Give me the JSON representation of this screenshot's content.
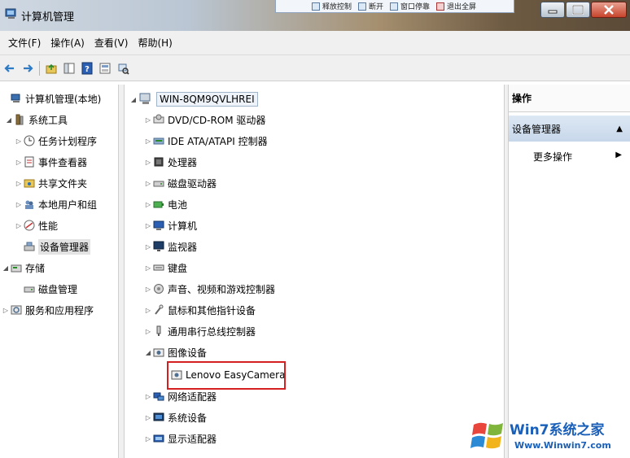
{
  "window": {
    "title": "计算机管理",
    "remote_bar": [
      "释放控制",
      "断开",
      "窗口停靠",
      "退出全屏"
    ]
  },
  "menubar": [
    "文件(F)",
    "操作(A)",
    "查看(V)",
    "帮助(H)"
  ],
  "left_tree": [
    {
      "label": "计算机管理(本地)",
      "icon": "computer-management-icon",
      "level": 0,
      "twisty": ""
    },
    {
      "label": "系统工具",
      "icon": "system-tools-icon",
      "level": 1,
      "twisty": "◢"
    },
    {
      "label": "任务计划程序",
      "icon": "clock-icon",
      "level": 2,
      "twisty": "▷"
    },
    {
      "label": "事件查看器",
      "icon": "event-viewer-icon",
      "level": 2,
      "twisty": "▷"
    },
    {
      "label": "共享文件夹",
      "icon": "shared-folder-icon",
      "level": 2,
      "twisty": "▷"
    },
    {
      "label": "本地用户和组",
      "icon": "users-icon",
      "level": 2,
      "twisty": "▷"
    },
    {
      "label": "性能",
      "icon": "performance-icon",
      "level": 2,
      "twisty": "▷"
    },
    {
      "label": "设备管理器",
      "icon": "device-manager-icon",
      "level": 2,
      "twisty": "",
      "selected": true
    },
    {
      "label": "存储",
      "icon": "storage-icon",
      "level": 0,
      "twisty": "◢"
    },
    {
      "label": "磁盘管理",
      "icon": "disk-management-icon",
      "level": 1,
      "twisty": ""
    },
    {
      "label": "服务和应用程序",
      "icon": "services-icon",
      "level": 0,
      "twisty": "▷"
    }
  ],
  "device_tree": {
    "root": "WIN-8QM9QVLHREI",
    "items": [
      {
        "label": "DVD/CD-ROM 驱动器",
        "icon": "dvd-drive-icon"
      },
      {
        "label": "IDE ATA/ATAPI 控制器",
        "icon": "ide-controller-icon"
      },
      {
        "label": "处理器",
        "icon": "processor-icon"
      },
      {
        "label": "磁盘驱动器",
        "icon": "disk-drive-icon"
      },
      {
        "label": "电池",
        "icon": "battery-icon"
      },
      {
        "label": "计算机",
        "icon": "computer-icon"
      },
      {
        "label": "监视器",
        "icon": "monitor-icon"
      },
      {
        "label": "键盘",
        "icon": "keyboard-icon"
      },
      {
        "label": "声音、视频和游戏控制器",
        "icon": "sound-icon"
      },
      {
        "label": "鼠标和其他指针设备",
        "icon": "mouse-icon"
      },
      {
        "label": "通用串行总线控制器",
        "icon": "usb-icon"
      },
      {
        "label": "图像设备",
        "icon": "imaging-device-icon",
        "expanded": true
      },
      {
        "label": "网络适配器",
        "icon": "network-adapter-icon"
      },
      {
        "label": "系统设备",
        "icon": "system-device-icon"
      },
      {
        "label": "显示适配器",
        "icon": "display-adapter-icon"
      }
    ],
    "camera": "Lenovo EasyCamera"
  },
  "actions_panel": {
    "header": "操作",
    "section": "设备管理器",
    "more": "更多操作"
  },
  "watermark": {
    "line1": "Win7系统之家",
    "line2": "Www.Winwin7.com"
  }
}
